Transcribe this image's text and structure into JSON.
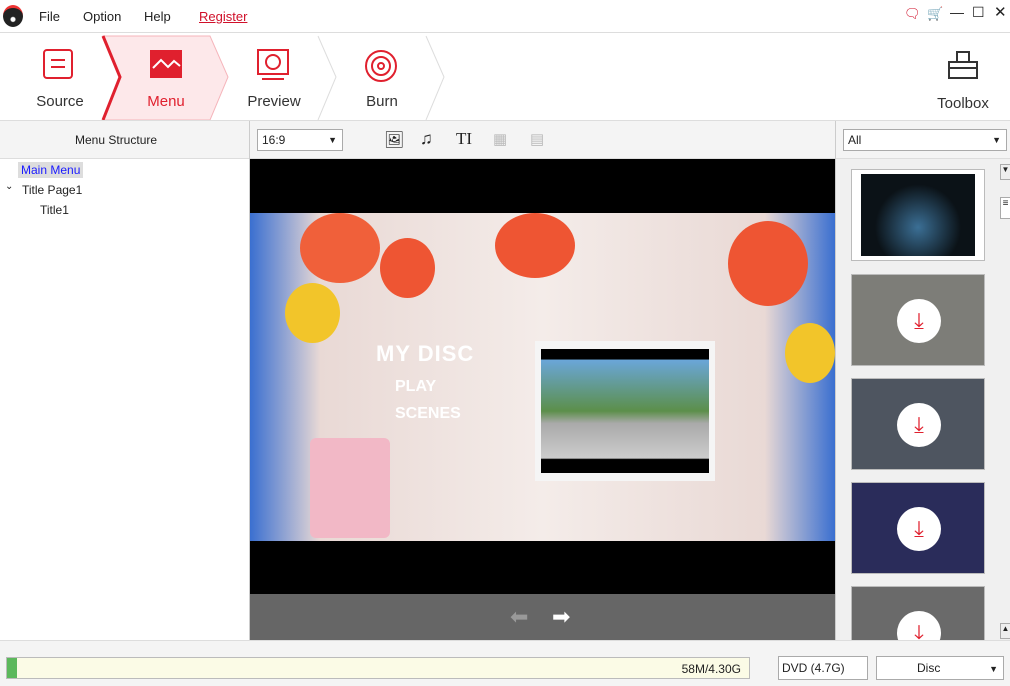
{
  "menubar": {
    "items": [
      "File",
      "Option",
      "Help"
    ],
    "register": "Register"
  },
  "steps": [
    {
      "label": "Source"
    },
    {
      "label": "Menu",
      "active": true
    },
    {
      "label": "Preview"
    },
    {
      "label": "Burn"
    }
  ],
  "toolbox": "Toolbox",
  "left": {
    "title": "Menu Structure",
    "tree": [
      {
        "label": "Main Menu",
        "selected": true
      },
      {
        "label": "Title Page1"
      },
      {
        "label": "Title1"
      }
    ]
  },
  "center": {
    "aspect": "16:9",
    "tools": [
      "image-icon",
      "music-icon",
      "text-icon",
      "grid-icon",
      "file-icon"
    ],
    "preview": {
      "title": "MY DISC",
      "items": [
        "PLAY",
        "SCENES"
      ]
    }
  },
  "right": {
    "filter": "All"
  },
  "bottom": {
    "progress_text": "58M/4.30G",
    "progress_fraction": 0.013,
    "disc_type": "DVD (4.7G)",
    "output": "Disc"
  },
  "colors": {
    "accent": "#e0202e",
    "active_bg": "#fde8ea"
  }
}
